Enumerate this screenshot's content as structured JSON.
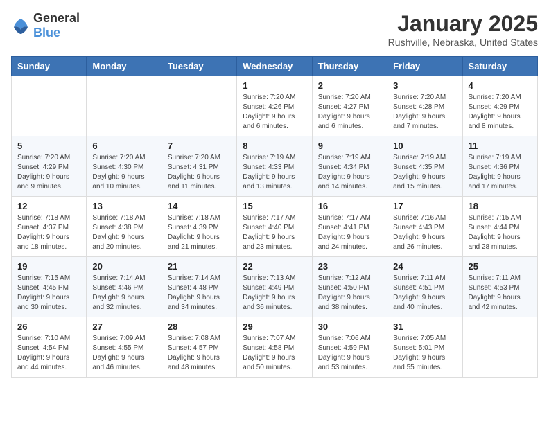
{
  "logo": {
    "general": "General",
    "blue": "Blue"
  },
  "title": "January 2025",
  "location": "Rushville, Nebraska, United States",
  "weekdays": [
    "Sunday",
    "Monday",
    "Tuesday",
    "Wednesday",
    "Thursday",
    "Friday",
    "Saturday"
  ],
  "weeks": [
    [
      {
        "day": "",
        "detail": ""
      },
      {
        "day": "",
        "detail": ""
      },
      {
        "day": "",
        "detail": ""
      },
      {
        "day": "1",
        "detail": "Sunrise: 7:20 AM\nSunset: 4:26 PM\nDaylight: 9 hours and 6 minutes."
      },
      {
        "day": "2",
        "detail": "Sunrise: 7:20 AM\nSunset: 4:27 PM\nDaylight: 9 hours and 6 minutes."
      },
      {
        "day": "3",
        "detail": "Sunrise: 7:20 AM\nSunset: 4:28 PM\nDaylight: 9 hours and 7 minutes."
      },
      {
        "day": "4",
        "detail": "Sunrise: 7:20 AM\nSunset: 4:29 PM\nDaylight: 9 hours and 8 minutes."
      }
    ],
    [
      {
        "day": "5",
        "detail": "Sunrise: 7:20 AM\nSunset: 4:29 PM\nDaylight: 9 hours and 9 minutes."
      },
      {
        "day": "6",
        "detail": "Sunrise: 7:20 AM\nSunset: 4:30 PM\nDaylight: 9 hours and 10 minutes."
      },
      {
        "day": "7",
        "detail": "Sunrise: 7:20 AM\nSunset: 4:31 PM\nDaylight: 9 hours and 11 minutes."
      },
      {
        "day": "8",
        "detail": "Sunrise: 7:19 AM\nSunset: 4:33 PM\nDaylight: 9 hours and 13 minutes."
      },
      {
        "day": "9",
        "detail": "Sunrise: 7:19 AM\nSunset: 4:34 PM\nDaylight: 9 hours and 14 minutes."
      },
      {
        "day": "10",
        "detail": "Sunrise: 7:19 AM\nSunset: 4:35 PM\nDaylight: 9 hours and 15 minutes."
      },
      {
        "day": "11",
        "detail": "Sunrise: 7:19 AM\nSunset: 4:36 PM\nDaylight: 9 hours and 17 minutes."
      }
    ],
    [
      {
        "day": "12",
        "detail": "Sunrise: 7:18 AM\nSunset: 4:37 PM\nDaylight: 9 hours and 18 minutes."
      },
      {
        "day": "13",
        "detail": "Sunrise: 7:18 AM\nSunset: 4:38 PM\nDaylight: 9 hours and 20 minutes."
      },
      {
        "day": "14",
        "detail": "Sunrise: 7:18 AM\nSunset: 4:39 PM\nDaylight: 9 hours and 21 minutes."
      },
      {
        "day": "15",
        "detail": "Sunrise: 7:17 AM\nSunset: 4:40 PM\nDaylight: 9 hours and 23 minutes."
      },
      {
        "day": "16",
        "detail": "Sunrise: 7:17 AM\nSunset: 4:41 PM\nDaylight: 9 hours and 24 minutes."
      },
      {
        "day": "17",
        "detail": "Sunrise: 7:16 AM\nSunset: 4:43 PM\nDaylight: 9 hours and 26 minutes."
      },
      {
        "day": "18",
        "detail": "Sunrise: 7:15 AM\nSunset: 4:44 PM\nDaylight: 9 hours and 28 minutes."
      }
    ],
    [
      {
        "day": "19",
        "detail": "Sunrise: 7:15 AM\nSunset: 4:45 PM\nDaylight: 9 hours and 30 minutes."
      },
      {
        "day": "20",
        "detail": "Sunrise: 7:14 AM\nSunset: 4:46 PM\nDaylight: 9 hours and 32 minutes."
      },
      {
        "day": "21",
        "detail": "Sunrise: 7:14 AM\nSunset: 4:48 PM\nDaylight: 9 hours and 34 minutes."
      },
      {
        "day": "22",
        "detail": "Sunrise: 7:13 AM\nSunset: 4:49 PM\nDaylight: 9 hours and 36 minutes."
      },
      {
        "day": "23",
        "detail": "Sunrise: 7:12 AM\nSunset: 4:50 PM\nDaylight: 9 hours and 38 minutes."
      },
      {
        "day": "24",
        "detail": "Sunrise: 7:11 AM\nSunset: 4:51 PM\nDaylight: 9 hours and 40 minutes."
      },
      {
        "day": "25",
        "detail": "Sunrise: 7:11 AM\nSunset: 4:53 PM\nDaylight: 9 hours and 42 minutes."
      }
    ],
    [
      {
        "day": "26",
        "detail": "Sunrise: 7:10 AM\nSunset: 4:54 PM\nDaylight: 9 hours and 44 minutes."
      },
      {
        "day": "27",
        "detail": "Sunrise: 7:09 AM\nSunset: 4:55 PM\nDaylight: 9 hours and 46 minutes."
      },
      {
        "day": "28",
        "detail": "Sunrise: 7:08 AM\nSunset: 4:57 PM\nDaylight: 9 hours and 48 minutes."
      },
      {
        "day": "29",
        "detail": "Sunrise: 7:07 AM\nSunset: 4:58 PM\nDaylight: 9 hours and 50 minutes."
      },
      {
        "day": "30",
        "detail": "Sunrise: 7:06 AM\nSunset: 4:59 PM\nDaylight: 9 hours and 53 minutes."
      },
      {
        "day": "31",
        "detail": "Sunrise: 7:05 AM\nSunset: 5:01 PM\nDaylight: 9 hours and 55 minutes."
      },
      {
        "day": "",
        "detail": ""
      }
    ]
  ]
}
